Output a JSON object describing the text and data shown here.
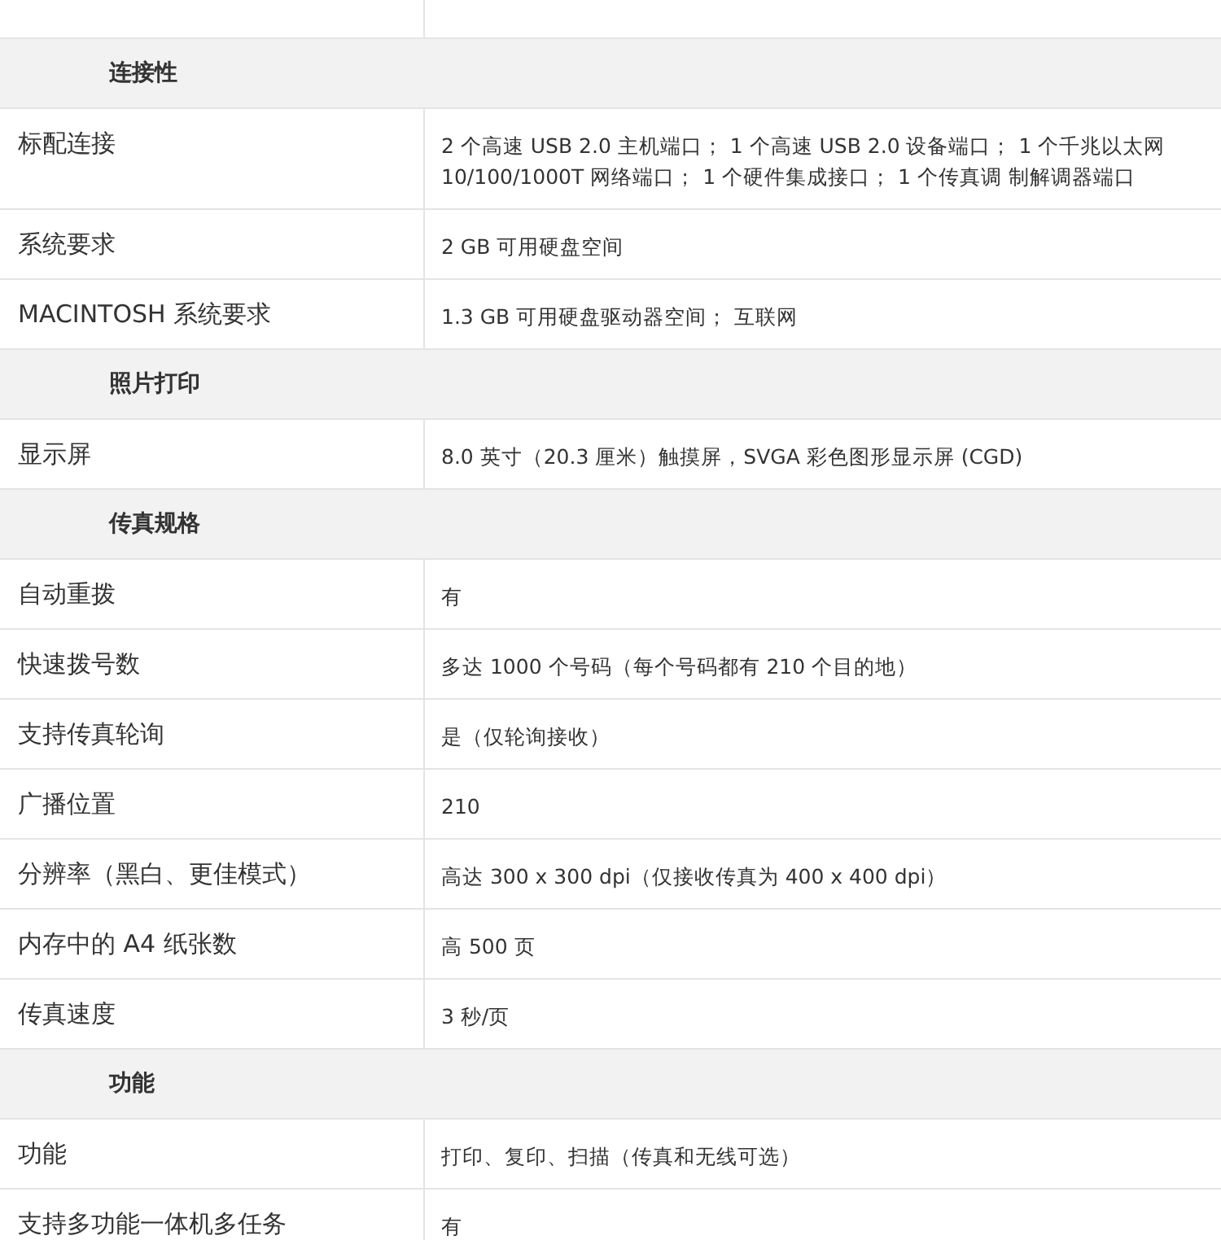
{
  "sections": [
    {
      "title": "连接性",
      "rows": [
        {
          "label": "标配连接",
          "value": "2 个高速 USB 2.0 主机端口； 1 个高速 USB 2.0 设备端口； 1 个千兆以太网 10/100/1000T 网络端口； 1 个硬件集成接口； 1 个传真调 制解调器端口"
        },
        {
          "label": "系统要求",
          "value": "2 GB 可用硬盘空间"
        },
        {
          "label": "MACINTOSH 系统要求",
          "value": "1.3 GB 可用硬盘驱动器空间； 互联网"
        }
      ]
    },
    {
      "title": "照片打印",
      "rows": [
        {
          "label": "显示屏",
          "value": "8.0 英寸（20.3 厘米）触摸屏，SVGA 彩色图形显示屏 (CGD)"
        }
      ]
    },
    {
      "title": "传真规格",
      "rows": [
        {
          "label": "自动重拨",
          "value": "有"
        },
        {
          "label": "快速拨号数",
          "value": "多达 1000 个号码（每个号码都有 210 个目的地）"
        },
        {
          "label": "支持传真轮询",
          "value": "是（仅轮询接收）"
        },
        {
          "label": "广播位置",
          "value": "210"
        },
        {
          "label": "分辨率（黑白、更佳模式）",
          "value": "高达 300 x 300 dpi（仅接收传真为 400 x 400 dpi）"
        },
        {
          "label": "内存中的 A4 纸张数",
          "value": "高 500 页"
        },
        {
          "label": "传真速度",
          "value": "3 秒/页"
        }
      ]
    },
    {
      "title": "功能",
      "rows": [
        {
          "label": "功能",
          "value": "打印、复印、扫描（传真和无线可选）"
        },
        {
          "label": "支持多功能一体机多任务",
          "value": "有"
        }
      ]
    }
  ]
}
